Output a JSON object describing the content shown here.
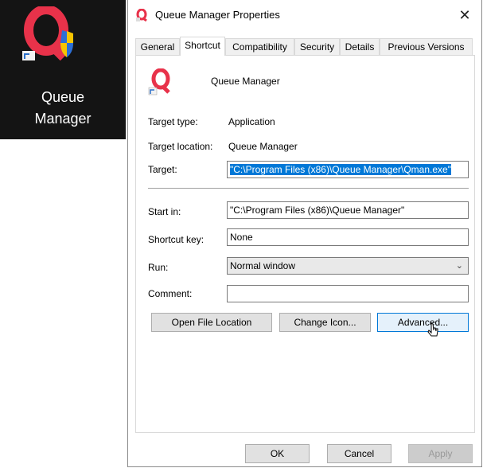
{
  "desktop": {
    "label_line1": "Queue",
    "label_line2": "Manager",
    "icon": "queue-manager-shortcut-icon"
  },
  "dialog": {
    "title": "Queue Manager Properties",
    "close_glyph": "✕",
    "tabs": [
      {
        "label": "General"
      },
      {
        "label": "Shortcut",
        "active": true
      },
      {
        "label": "Compatibility"
      },
      {
        "label": "Security"
      },
      {
        "label": "Details"
      },
      {
        "label": "Previous Versions"
      }
    ]
  },
  "shortcut": {
    "app_name": "Queue Manager",
    "target_type_label": "Target type:",
    "target_type_value": "Application",
    "target_location_label": "Target location:",
    "target_location_value": "Queue Manager",
    "target_label": "Target:",
    "target_value": "\"C:\\Program Files (x86)\\Queue Manager\\Qman.exe\"",
    "start_in_label": "Start in:",
    "start_in_value": "\"C:\\Program Files (x86)\\Queue Manager\"",
    "shortcut_key_label": "Shortcut key:",
    "shortcut_key_value": "None",
    "run_label": "Run:",
    "run_value": "Normal window",
    "comment_label": "Comment:",
    "comment_value": "",
    "open_file_location": "Open File Location",
    "change_icon": "Change Icon...",
    "advanced": "Advanced..."
  },
  "footer": {
    "ok": "OK",
    "cancel": "Cancel",
    "apply": "Apply"
  },
  "colors": {
    "brand_red": "#e8324a",
    "selection_blue": "#0078d7"
  }
}
